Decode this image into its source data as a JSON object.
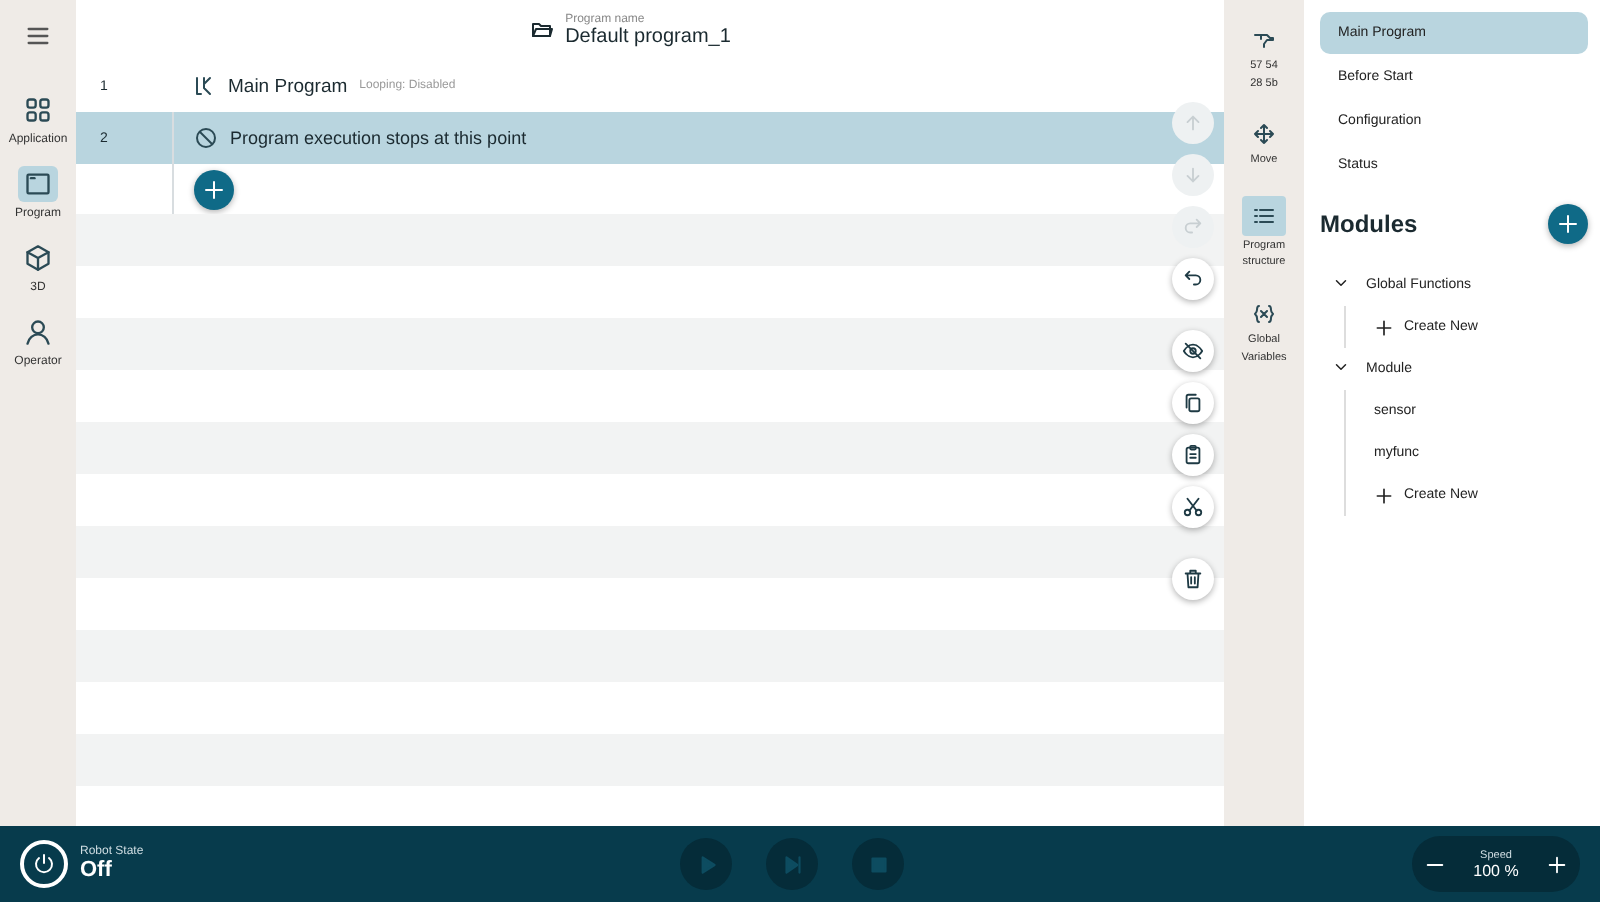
{
  "nav": {
    "items": [
      {
        "kind": "grid",
        "label": "Application",
        "selected": false
      },
      {
        "kind": "program",
        "label": "Program",
        "selected": true
      },
      {
        "kind": "cube",
        "label": "3D",
        "selected": false
      },
      {
        "kind": "person",
        "label": "Operator",
        "selected": false
      }
    ]
  },
  "header": {
    "caption": "Program name",
    "name": "Default program_1"
  },
  "lines": [
    {
      "number": "1",
      "kind": "main",
      "title": "Main Program",
      "meta_label": "Looping:",
      "meta_value": "Disabled",
      "selected": false
    },
    {
      "number": "2",
      "kind": "stop",
      "title": "Program execution stops at this point",
      "selected": true
    }
  ],
  "tools": [
    {
      "kind": "up",
      "disabled": true
    },
    {
      "kind": "down",
      "disabled": true
    },
    {
      "kind": "redo",
      "disabled": true
    },
    {
      "kind": "undo",
      "disabled": false
    },
    {
      "kind": "hide",
      "disabled": false
    },
    {
      "kind": "copy",
      "disabled": false
    },
    {
      "kind": "paste",
      "disabled": false
    },
    {
      "kind": "cut",
      "disabled": false
    },
    {
      "kind": "delete",
      "disabled": false
    }
  ],
  "rail": {
    "items": [
      {
        "kind": "robot",
        "lines": [
          "57 54",
          "28 5b"
        ],
        "selected": false
      },
      {
        "kind": "move",
        "lines": [
          "Move"
        ],
        "selected": false
      },
      {
        "kind": "structure",
        "lines": [
          "Program",
          "structure"
        ],
        "selected": true
      },
      {
        "kind": "variables",
        "lines": [
          "Global",
          "Variables"
        ],
        "selected": false
      }
    ]
  },
  "sections": [
    {
      "label": "Main Program",
      "selected": true
    },
    {
      "label": "Before Start",
      "selected": false
    },
    {
      "label": "Configuration",
      "selected": false
    },
    {
      "label": "Status",
      "selected": false
    }
  ],
  "modules": {
    "title": "Modules",
    "tree": [
      {
        "label": "Global Functions",
        "expanded": true,
        "children": [
          {
            "label": "Create New",
            "kind": "create"
          }
        ]
      },
      {
        "label": "Module",
        "expanded": true,
        "children": [
          {
            "label": "sensor",
            "kind": "item"
          },
          {
            "label": "myfunc",
            "kind": "item"
          },
          {
            "label": "Create New",
            "kind": "create"
          }
        ]
      }
    ]
  },
  "status_bar": {
    "robot_state_label": "Robot State",
    "robot_state": "Off",
    "controls": [
      {
        "kind": "play",
        "disabled": true
      },
      {
        "kind": "step",
        "disabled": true
      },
      {
        "kind": "stop",
        "disabled": true
      }
    ],
    "speed_label": "Speed",
    "speed": "100 %"
  }
}
